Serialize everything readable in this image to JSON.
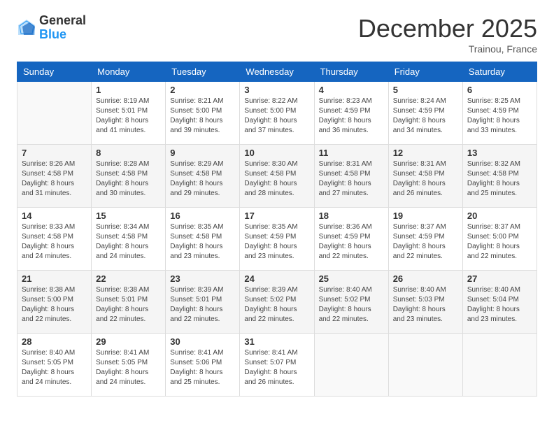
{
  "header": {
    "logo_general": "General",
    "logo_blue": "Blue",
    "month_title": "December 2025",
    "location": "Trainou, France"
  },
  "calendar": {
    "columns": [
      "Sunday",
      "Monday",
      "Tuesday",
      "Wednesday",
      "Thursday",
      "Friday",
      "Saturday"
    ],
    "weeks": [
      [
        {
          "day": "",
          "sunrise": "",
          "sunset": "",
          "daylight": ""
        },
        {
          "day": "1",
          "sunrise": "Sunrise: 8:19 AM",
          "sunset": "Sunset: 5:01 PM",
          "daylight": "Daylight: 8 hours and 41 minutes."
        },
        {
          "day": "2",
          "sunrise": "Sunrise: 8:21 AM",
          "sunset": "Sunset: 5:00 PM",
          "daylight": "Daylight: 8 hours and 39 minutes."
        },
        {
          "day": "3",
          "sunrise": "Sunrise: 8:22 AM",
          "sunset": "Sunset: 5:00 PM",
          "daylight": "Daylight: 8 hours and 37 minutes."
        },
        {
          "day": "4",
          "sunrise": "Sunrise: 8:23 AM",
          "sunset": "Sunset: 4:59 PM",
          "daylight": "Daylight: 8 hours and 36 minutes."
        },
        {
          "day": "5",
          "sunrise": "Sunrise: 8:24 AM",
          "sunset": "Sunset: 4:59 PM",
          "daylight": "Daylight: 8 hours and 34 minutes."
        },
        {
          "day": "6",
          "sunrise": "Sunrise: 8:25 AM",
          "sunset": "Sunset: 4:59 PM",
          "daylight": "Daylight: 8 hours and 33 minutes."
        }
      ],
      [
        {
          "day": "7",
          "sunrise": "Sunrise: 8:26 AM",
          "sunset": "Sunset: 4:58 PM",
          "daylight": "Daylight: 8 hours and 31 minutes."
        },
        {
          "day": "8",
          "sunrise": "Sunrise: 8:28 AM",
          "sunset": "Sunset: 4:58 PM",
          "daylight": "Daylight: 8 hours and 30 minutes."
        },
        {
          "day": "9",
          "sunrise": "Sunrise: 8:29 AM",
          "sunset": "Sunset: 4:58 PM",
          "daylight": "Daylight: 8 hours and 29 minutes."
        },
        {
          "day": "10",
          "sunrise": "Sunrise: 8:30 AM",
          "sunset": "Sunset: 4:58 PM",
          "daylight": "Daylight: 8 hours and 28 minutes."
        },
        {
          "day": "11",
          "sunrise": "Sunrise: 8:31 AM",
          "sunset": "Sunset: 4:58 PM",
          "daylight": "Daylight: 8 hours and 27 minutes."
        },
        {
          "day": "12",
          "sunrise": "Sunrise: 8:31 AM",
          "sunset": "Sunset: 4:58 PM",
          "daylight": "Daylight: 8 hours and 26 minutes."
        },
        {
          "day": "13",
          "sunrise": "Sunrise: 8:32 AM",
          "sunset": "Sunset: 4:58 PM",
          "daylight": "Daylight: 8 hours and 25 minutes."
        }
      ],
      [
        {
          "day": "14",
          "sunrise": "Sunrise: 8:33 AM",
          "sunset": "Sunset: 4:58 PM",
          "daylight": "Daylight: 8 hours and 24 minutes."
        },
        {
          "day": "15",
          "sunrise": "Sunrise: 8:34 AM",
          "sunset": "Sunset: 4:58 PM",
          "daylight": "Daylight: 8 hours and 24 minutes."
        },
        {
          "day": "16",
          "sunrise": "Sunrise: 8:35 AM",
          "sunset": "Sunset: 4:58 PM",
          "daylight": "Daylight: 8 hours and 23 minutes."
        },
        {
          "day": "17",
          "sunrise": "Sunrise: 8:35 AM",
          "sunset": "Sunset: 4:59 PM",
          "daylight": "Daylight: 8 hours and 23 minutes."
        },
        {
          "day": "18",
          "sunrise": "Sunrise: 8:36 AM",
          "sunset": "Sunset: 4:59 PM",
          "daylight": "Daylight: 8 hours and 22 minutes."
        },
        {
          "day": "19",
          "sunrise": "Sunrise: 8:37 AM",
          "sunset": "Sunset: 4:59 PM",
          "daylight": "Daylight: 8 hours and 22 minutes."
        },
        {
          "day": "20",
          "sunrise": "Sunrise: 8:37 AM",
          "sunset": "Sunset: 5:00 PM",
          "daylight": "Daylight: 8 hours and 22 minutes."
        }
      ],
      [
        {
          "day": "21",
          "sunrise": "Sunrise: 8:38 AM",
          "sunset": "Sunset: 5:00 PM",
          "daylight": "Daylight: 8 hours and 22 minutes."
        },
        {
          "day": "22",
          "sunrise": "Sunrise: 8:38 AM",
          "sunset": "Sunset: 5:01 PM",
          "daylight": "Daylight: 8 hours and 22 minutes."
        },
        {
          "day": "23",
          "sunrise": "Sunrise: 8:39 AM",
          "sunset": "Sunset: 5:01 PM",
          "daylight": "Daylight: 8 hours and 22 minutes."
        },
        {
          "day": "24",
          "sunrise": "Sunrise: 8:39 AM",
          "sunset": "Sunset: 5:02 PM",
          "daylight": "Daylight: 8 hours and 22 minutes."
        },
        {
          "day": "25",
          "sunrise": "Sunrise: 8:40 AM",
          "sunset": "Sunset: 5:02 PM",
          "daylight": "Daylight: 8 hours and 22 minutes."
        },
        {
          "day": "26",
          "sunrise": "Sunrise: 8:40 AM",
          "sunset": "Sunset: 5:03 PM",
          "daylight": "Daylight: 8 hours and 23 minutes."
        },
        {
          "day": "27",
          "sunrise": "Sunrise: 8:40 AM",
          "sunset": "Sunset: 5:04 PM",
          "daylight": "Daylight: 8 hours and 23 minutes."
        }
      ],
      [
        {
          "day": "28",
          "sunrise": "Sunrise: 8:40 AM",
          "sunset": "Sunset: 5:05 PM",
          "daylight": "Daylight: 8 hours and 24 minutes."
        },
        {
          "day": "29",
          "sunrise": "Sunrise: 8:41 AM",
          "sunset": "Sunset: 5:05 PM",
          "daylight": "Daylight: 8 hours and 24 minutes."
        },
        {
          "day": "30",
          "sunrise": "Sunrise: 8:41 AM",
          "sunset": "Sunset: 5:06 PM",
          "daylight": "Daylight: 8 hours and 25 minutes."
        },
        {
          "day": "31",
          "sunrise": "Sunrise: 8:41 AM",
          "sunset": "Sunset: 5:07 PM",
          "daylight": "Daylight: 8 hours and 26 minutes."
        },
        {
          "day": "",
          "sunrise": "",
          "sunset": "",
          "daylight": ""
        },
        {
          "day": "",
          "sunrise": "",
          "sunset": "",
          "daylight": ""
        },
        {
          "day": "",
          "sunrise": "",
          "sunset": "",
          "daylight": ""
        }
      ]
    ]
  }
}
